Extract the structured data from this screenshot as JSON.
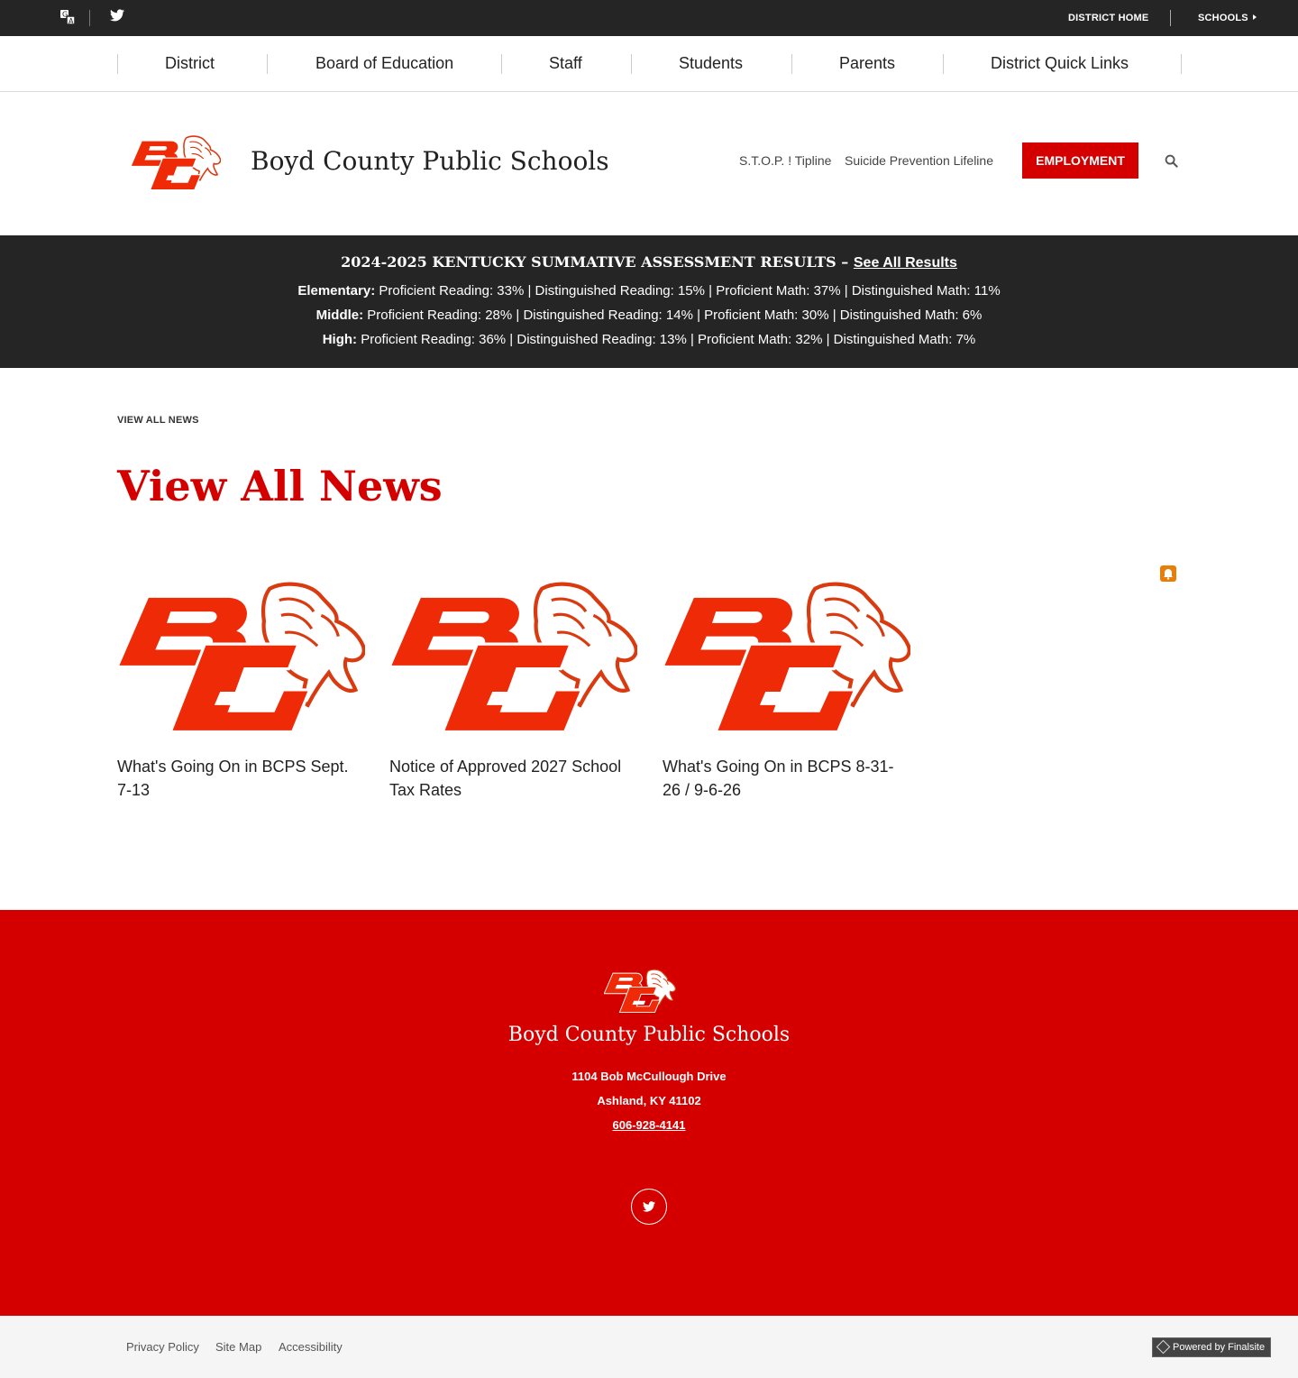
{
  "utility": {
    "translate_icon": "translate-icon",
    "twitter_icon": "twitter-icon",
    "district_home": "DISTRICT HOME",
    "schools": "SCHOOLS"
  },
  "nav": {
    "items": [
      "District",
      "Board of Education",
      "Staff",
      "Students",
      "Parents",
      "District Quick Links"
    ]
  },
  "header": {
    "site_title": "Boyd County Public Schools",
    "links": [
      "S.T.O.P. ! Tipline",
      "Suicide Prevention Lifeline"
    ],
    "employment": "EMPLOYMENT",
    "search_icon": "search-icon"
  },
  "banner": {
    "title": "2024-2025 KENTUCKY SUMMATIVE ASSESSMENT RESULTS – ",
    "link": "See All Results",
    "rows": [
      {
        "label": "Elementary:",
        "text": " Proficient Reading: 33% | Distinguished Reading: 15% | Proficient Math: 37% | Distinguished Math: 11%"
      },
      {
        "label": "Middle:",
        "text": " Proficient Reading: 28% | Distinguished Reading: 14% | Proficient Math: 30% | Distinguished Math: 6%"
      },
      {
        "label": "High:",
        "text": " Proficient Reading: 36% | Distinguished Reading: 13% | Proficient Math: 32% | Distinguished Math: 7%"
      }
    ]
  },
  "content": {
    "breadcrumb": "VIEW ALL NEWS",
    "page_title": "View All News",
    "rss_icon": "rss-icon",
    "news": [
      {
        "title": "What's Going On in BCPS Sept. 7-13"
      },
      {
        "title": "Notice of Approved 2027 School Tax Rates"
      },
      {
        "title": "What's Going On in BCPS 8-31-26 / 9-6-26"
      }
    ]
  },
  "footer": {
    "title": "Boyd County Public Schools",
    "address1": "1104 Bob McCullough Drive",
    "address2": "Ashland, KY  41102",
    "phone": "606-928-4141",
    "twitter_icon": "twitter-icon"
  },
  "bottom": {
    "links": [
      "Privacy Policy",
      "Site Map",
      "Accessibility"
    ],
    "powered": "Powered by Finalsite"
  },
  "colors": {
    "brand_red": "#d40000",
    "dark_bar": "#252525",
    "rss_orange": "#e97d0a"
  }
}
